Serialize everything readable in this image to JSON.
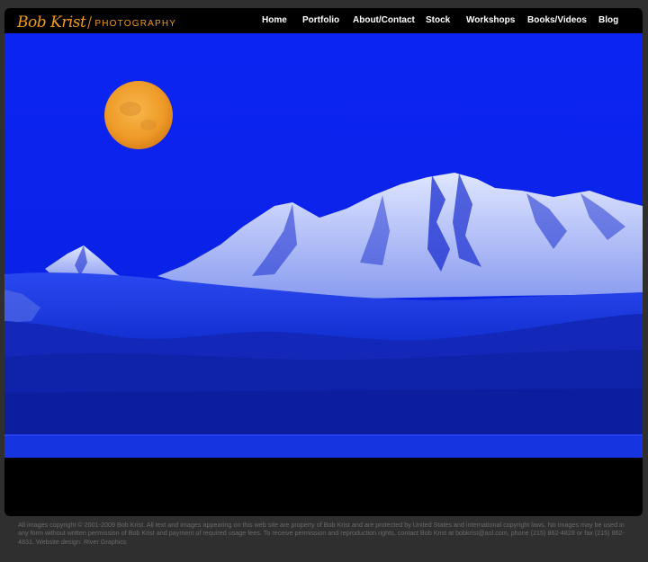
{
  "logo": {
    "script_text": "Bob Krist",
    "tagline": "PHOTOGRAPHY"
  },
  "nav": {
    "items": [
      {
        "label": "Home"
      },
      {
        "label": "Portfolio"
      },
      {
        "label": "About/Contact"
      },
      {
        "label": "Stock"
      },
      {
        "label": "Workshops"
      },
      {
        "label": "Books/Videos"
      },
      {
        "label": "Blog"
      }
    ]
  },
  "footer": {
    "copyright": "All images copyright © 2001-2009 Bob Krist. All text and images appearing on this web site are property of Bob Krist and are protected by United States and international copyright laws. No images may be used in any form without written permission of Bob Krist and payment of required usage fees. To receive permission and reproduction rights, contact Bob Krist at bobkrist@aol.com, phone (215) 862-4828 or fax (215) 862-4831. Website design: River Graphics"
  },
  "colors": {
    "accent": "#f29a1c",
    "page_background": "#2f2f2f",
    "frame_background": "#000000",
    "sky_blue": "#0a23ee",
    "moon_orange": "#f0a02a"
  }
}
